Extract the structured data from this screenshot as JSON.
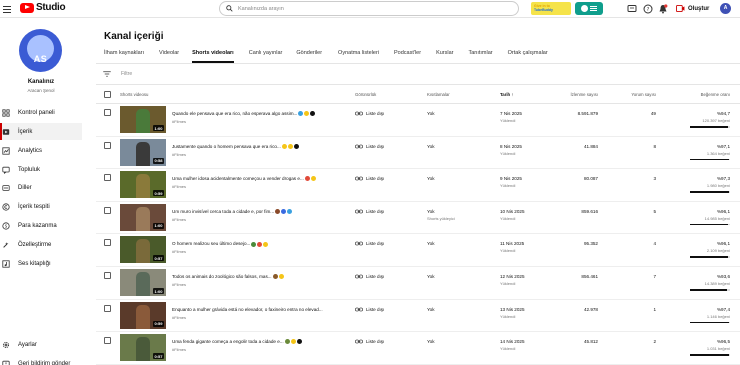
{
  "topbar": {
    "logo_text": "Studio",
    "search_placeholder": "Kanalınızda arayın",
    "promo_line1": "Give in to",
    "promo_line2": "TubeBuddy",
    "create_label": "Oluştur",
    "avatar_letter": "A"
  },
  "sidebar": {
    "avatar_letters": "AS",
    "channel_name": "Kanalınız",
    "channel_sub": "Aracan Şenol",
    "nav": [
      {
        "label": "Kontrol paneli",
        "icon": "dashboard-icon"
      },
      {
        "label": "İçerik",
        "icon": "content-icon",
        "active": true
      },
      {
        "label": "Analytics",
        "icon": "analytics-icon"
      },
      {
        "label": "Topluluk",
        "icon": "community-icon"
      },
      {
        "label": "Diller",
        "icon": "subtitles-icon"
      },
      {
        "label": "İçerik tespiti",
        "icon": "copyright-icon"
      },
      {
        "label": "Para kazanma",
        "icon": "monetization-icon"
      },
      {
        "label": "Özelleştirme",
        "icon": "customization-icon"
      },
      {
        "label": "Ses kitaplığı",
        "icon": "audio-library-icon"
      }
    ],
    "bottom": [
      {
        "label": "Ayarlar",
        "icon": "settings-icon"
      },
      {
        "label": "Geri bildirim gönder",
        "icon": "feedback-icon"
      }
    ]
  },
  "page": {
    "title": "Kanal içeriği",
    "tabs": [
      "İlham kaynakları",
      "Videolar",
      "Shorts videoları",
      "Canlı yayınlar",
      "Gönderiler",
      "Oynatma listeleri",
      "Podcast'ler",
      "Kurslar",
      "Tanıtımlar",
      "Ortak çalışmalar"
    ],
    "active_tab": 2,
    "filter_label": "Filtre"
  },
  "table": {
    "headers": {
      "video": "Shorts videosu",
      "visibility": "Görünürlük",
      "restrictions": "Kısıtlamalar",
      "date": "Tarih",
      "views": "İzlenme sayısı",
      "comments": "Yorum sayısı",
      "likes": "Beğenme oranı"
    },
    "rows": [
      {
        "title": "Quando ele pensava que era rico, não esperava algo assim...",
        "tag": "#Filmes",
        "duration": "1:00",
        "visibility": "Liste dışı",
        "restriction": "Yok",
        "restriction_note": "",
        "date": "7 Nis 2025",
        "date_status": "Yüklendi",
        "views": "8.591.879",
        "comments": "49",
        "like_pct": "%94,7",
        "like_count": "120.397 beğeni",
        "like_ratio": 0.947,
        "emojis": [
          "#3aa0e0",
          "#f5c518",
          "#111111"
        ],
        "thumb": [
          "#6b5a2e",
          "#4a7a3a"
        ]
      },
      {
        "title": "Justamente quando o homem pensava que era rico...",
        "tag": "#Filmes",
        "duration": "0:58",
        "visibility": "Liste dışı",
        "restriction": "Yok",
        "restriction_note": "",
        "date": "8 Nis 2025",
        "date_status": "Yüklendi",
        "views": "41.884",
        "comments": "8",
        "like_pct": "%97,1",
        "like_count": "1.364 beğeni",
        "like_ratio": 0.971,
        "emojis": [
          "#f5c518",
          "#f5c518",
          "#111111"
        ],
        "thumb": [
          "#7a8a9a",
          "#3a3a3a"
        ]
      },
      {
        "title": "Uma mulher idosa acidentalmente começou a vender drogas e...",
        "tag": "#Filmes",
        "duration": "0:59",
        "visibility": "Liste dışı",
        "restriction": "Yok",
        "restriction_note": "",
        "date": "9 Nis 2025",
        "date_status": "Yüklendi",
        "views": "80.087",
        "comments": "3",
        "like_pct": "%97,3",
        "like_count": "1.980 beğeni",
        "like_ratio": 0.973,
        "emojis": [
          "#e04a3a",
          "#f5c518"
        ],
        "thumb": [
          "#5a6a2a",
          "#8a7a3a"
        ]
      },
      {
        "title": "Um muro invisível cerca toda a cidade e, por fim...",
        "tag": "#Filmes",
        "duration": "1:00",
        "visibility": "Liste dışı",
        "restriction": "Yok",
        "restriction_note": "Shorts yükleyici",
        "date": "10 Nis 2025",
        "date_status": "Yüklendi",
        "views": "859.616",
        "comments": "5",
        "like_pct": "%96,1",
        "like_count": "14.985 beğeni",
        "like_ratio": 0.961,
        "emojis": [
          "#8a4a2a",
          "#3a6ae0",
          "#3aa0e0"
        ],
        "thumb": [
          "#6a4a3a",
          "#9a7a5a"
        ]
      },
      {
        "title": "O homem realizou seu último desejo...",
        "tag": "#Filmes",
        "duration": "0:57",
        "visibility": "Liste dışı",
        "restriction": "Yok",
        "restriction_note": "",
        "date": "11 Nis 2025",
        "date_status": "Yüklendi",
        "views": "95.352",
        "comments": "4",
        "like_pct": "%96,1",
        "like_count": "2.109 beğeni",
        "like_ratio": 0.961,
        "emojis": [
          "#4a8a3a",
          "#e04a3a",
          "#f5c518"
        ],
        "thumb": [
          "#4a5a2a",
          "#7a6a3a"
        ]
      },
      {
        "title": "Todos os animais do zoológico são falsos, mas...",
        "tag": "#Filmes",
        "duration": "1:00",
        "visibility": "Liste dışı",
        "restriction": "Yok",
        "restriction_note": "",
        "date": "12 Nis 2025",
        "date_status": "Yüklendi",
        "views": "856.461",
        "comments": "7",
        "like_pct": "%93,6",
        "like_count": "14.389 beğeni",
        "like_ratio": 0.936,
        "emojis": [
          "#8a5a2a",
          "#f5c518"
        ],
        "thumb": [
          "#8a8a7a",
          "#5a6a5a"
        ]
      },
      {
        "title": "Enquanto a mulher grávida está no elevador, o faxineiro entra no elevad...",
        "tag": "#Filmes",
        "duration": "0:59",
        "visibility": "Liste dışı",
        "restriction": "Yok",
        "restriction_note": "",
        "date": "13 Nis 2025",
        "date_status": "Yüklendi",
        "views": "42.978",
        "comments": "1",
        "like_pct": "%97,4",
        "like_count": "1.146 beğeni",
        "like_ratio": 0.974,
        "emojis": [],
        "thumb": [
          "#5a3a2a",
          "#8a5a3a"
        ]
      },
      {
        "title": "Uma fenda gigante começa a engolir toda a cidade e...",
        "tag": "#Filmes",
        "duration": "0:57",
        "visibility": "Liste dışı",
        "restriction": "Yok",
        "restriction_note": "",
        "date": "14 Nis 2025",
        "date_status": "Yüklendi",
        "views": "45.812",
        "comments": "2",
        "like_pct": "%96,5",
        "like_count": "1.031 beğeni",
        "like_ratio": 0.965,
        "emojis": [
          "#6a8a3a",
          "#f5c518",
          "#111111"
        ],
        "thumb": [
          "#6a7a4a",
          "#4a5a3a"
        ]
      }
    ]
  }
}
